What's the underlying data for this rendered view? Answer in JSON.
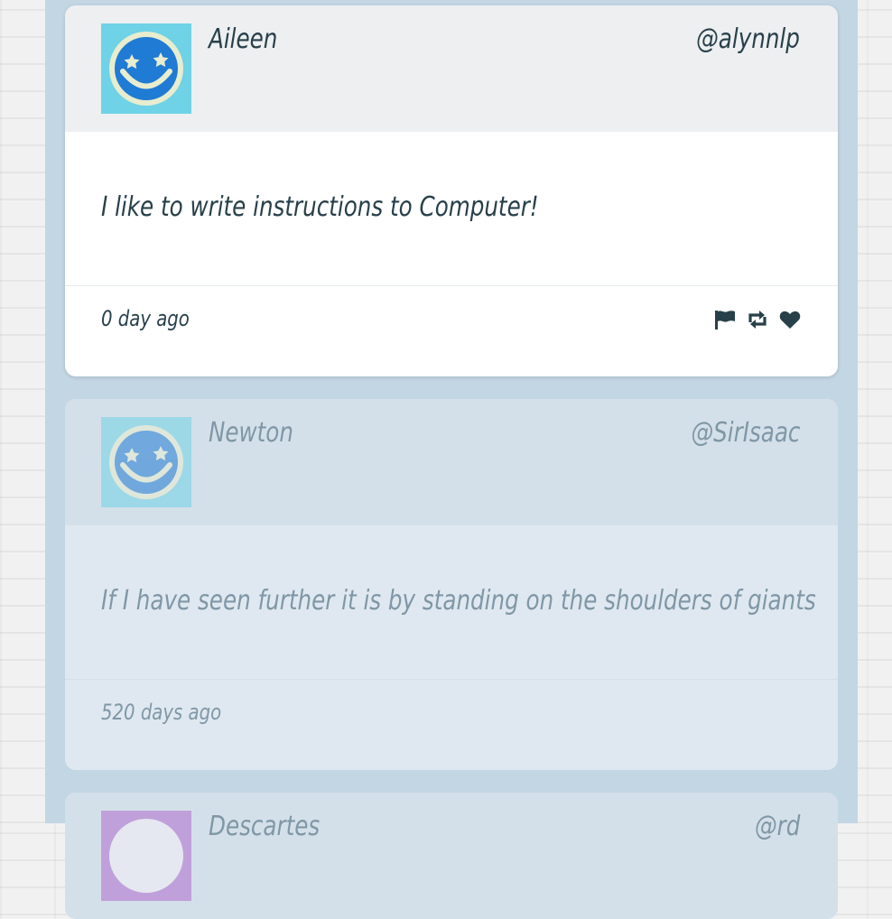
{
  "tweets": [
    {
      "name": "Aileen",
      "handle": "@alynnlp",
      "text": "I like to write instructions to Computer!",
      "time": "0 day ago",
      "avatar_color": "#6fd2e6"
    },
    {
      "name": "Newton",
      "handle": "@SirIsaac",
      "text": "If I have seen further it is by standing on the shoulders of giants",
      "time": "520 days ago",
      "avatar_color": "#6fd2e6"
    },
    {
      "name": "Descartes",
      "handle": "@rd",
      "avatar_color": "#b16ccf"
    }
  ],
  "icons": {
    "flag": "flag-icon",
    "retweet": "retweet-icon",
    "like": "heart-icon"
  },
  "colors": {
    "column_bg": "#c3d6e4",
    "text_dark": "#28404a",
    "text_muted": "#7f97a6"
  }
}
